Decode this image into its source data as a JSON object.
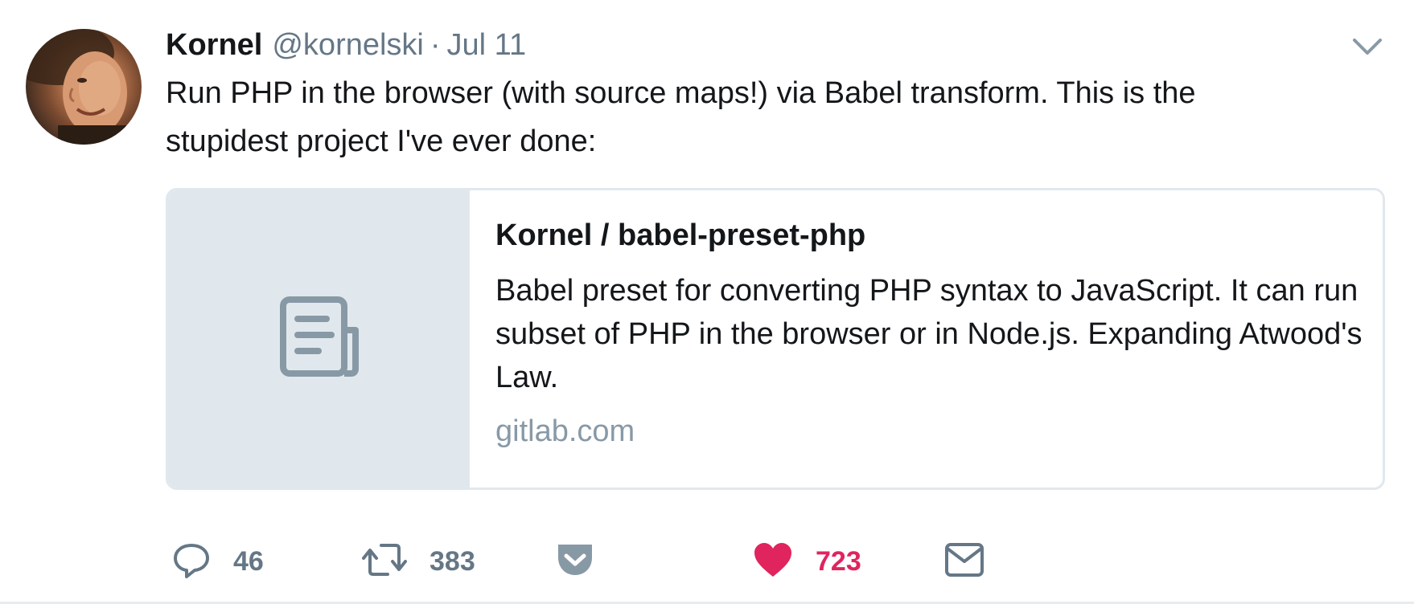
{
  "tweet": {
    "author_name": "Kornel",
    "author_handle": "@kornelski",
    "separator": "·",
    "date": "Jul 11",
    "text": "Run PHP in the browser (with source maps!) via Babel transform. This is the stupidest project I've ever done:"
  },
  "card": {
    "title": "Kornel / babel-preset-php",
    "description": "Babel preset for converting PHP syntax to JavaScript. It can run subset of PHP in the browser or in Node.js. Expanding Atwood's Law.",
    "domain": "gitlab.com",
    "thumbnail_icon": "document-icon"
  },
  "actions": {
    "reply": {
      "icon": "reply-icon",
      "count": "46"
    },
    "retweet": {
      "icon": "retweet-icon",
      "count": "383"
    },
    "pocket": {
      "icon": "pocket-icon"
    },
    "like": {
      "icon": "heart-icon",
      "count": "723",
      "active": true
    },
    "message": {
      "icon": "envelope-icon"
    }
  },
  "colors": {
    "text_primary": "#14171a",
    "text_secondary": "#657786",
    "domain_gray": "#8899a6",
    "card_border": "#e1e8ed",
    "like_red": "#e0245e"
  }
}
